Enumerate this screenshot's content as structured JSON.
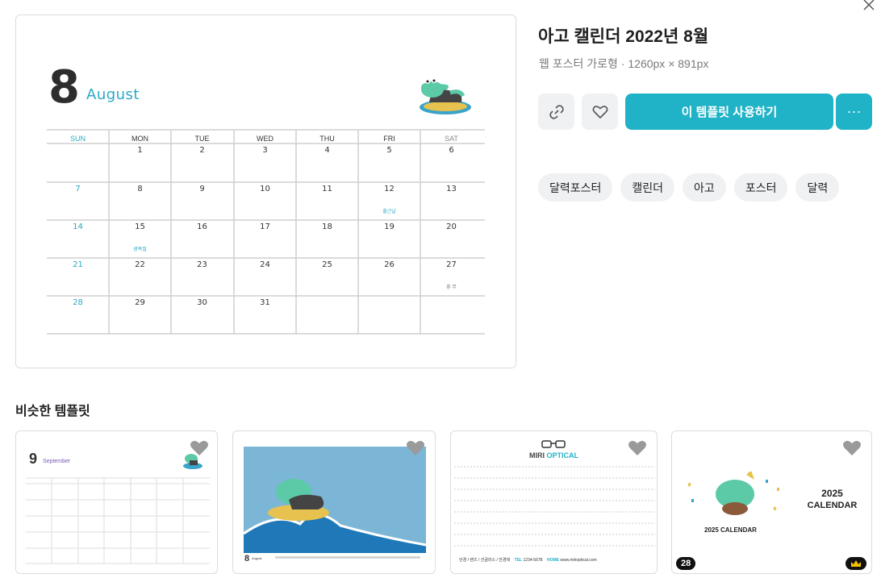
{
  "template": {
    "title": "아고 캘린더 2022년 8월",
    "subtitle": "웹 포스터 가로형 · 1260px × 891px"
  },
  "actions": {
    "link_icon": "link-icon",
    "like_icon": "heart-icon",
    "use_label": "이 템플릿 사용하기",
    "more_label": "···"
  },
  "tags": [
    "달력포스터",
    "캘린더",
    "아고",
    "포스터",
    "달력"
  ],
  "calendar": {
    "number": "8",
    "month": "August",
    "weekdays": [
      "SUN",
      "MON",
      "TUE",
      "WED",
      "THU",
      "FRI",
      "SAT"
    ],
    "weeks": [
      [
        "",
        "1",
        "2",
        "3",
        "4",
        "5",
        "6"
      ],
      [
        "7",
        "8",
        "9",
        "10",
        "11",
        "12",
        "13"
      ],
      [
        "14",
        "15",
        "16",
        "17",
        "18",
        "19",
        "20"
      ],
      [
        "21",
        "22",
        "23",
        "24",
        "25",
        "26",
        "27"
      ],
      [
        "28",
        "29",
        "30",
        "31",
        "",
        "",
        ""
      ]
    ],
    "notes": [
      {
        "week": 1,
        "day": 5,
        "text": "출근날"
      },
      {
        "week": 2,
        "day": 1,
        "text": "광복절"
      },
      {
        "week": 3,
        "day": 6,
        "text": "휴 무"
      }
    ],
    "accent": "#2aa9c6"
  },
  "similar": {
    "title": "비슷한 템플릿",
    "cards": [
      {
        "number": "9",
        "month": "September"
      },
      {
        "number": "8",
        "month": "August"
      },
      {
        "brand_a": "MIRI ",
        "brand_b": "OPTICAL",
        "footer": "안경 / 렌즈 / 선글라스 / 안경테",
        "tel_label": "TEL",
        "tel": "1234-5678",
        "home_label": "HOME",
        "home": "www.mirioptical.com"
      },
      {
        "year": "2025",
        "word": "CALENDAR",
        "cake_label": "2025 CALENDAR",
        "badge": "28"
      }
    ]
  },
  "colors": {
    "primary": "#20b2c6",
    "accent": "#2aa9c6"
  }
}
